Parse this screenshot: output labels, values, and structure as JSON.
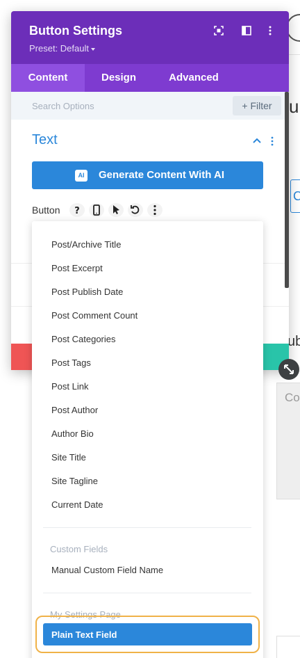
{
  "modal": {
    "title": "Button Settings",
    "preset": "Preset: Default",
    "header_icons": [
      "expand-icon",
      "sidebar-icon",
      "more-vertical-icon"
    ],
    "header_color": "#6c2eb9"
  },
  "tabs": [
    {
      "label": "Content",
      "active": true
    },
    {
      "label": "Design",
      "active": false
    },
    {
      "label": "Advanced",
      "active": false
    }
  ],
  "search": {
    "placeholder": "Search Options",
    "filter_label": "+ Filter"
  },
  "section": {
    "title": "Text"
  },
  "ai_button": {
    "badge": "AI",
    "label": "Generate Content With AI",
    "color": "#2b87da"
  },
  "field": {
    "label": "Button",
    "option_icons": [
      "help-icon",
      "mobile-icon",
      "cursor-icon",
      "undo-icon",
      "more-vertical-icon"
    ]
  },
  "dropdown": {
    "items": [
      "Post/Archive Title",
      "Post Excerpt",
      "Post Publish Date",
      "Post Comment Count",
      "Post Categories",
      "Post Tags",
      "Post Link",
      "Post Author",
      "Author Bio",
      "Site Title",
      "Site Tagline",
      "Current Date"
    ],
    "groups": [
      {
        "label": "Custom Fields",
        "items": [
          "Manual Custom Field Name"
        ]
      },
      {
        "label": "My Settings Page",
        "items": [
          "Plain Text Field"
        ]
      }
    ],
    "selected": "Plain Text Field",
    "highlight_color": "#f0b248"
  },
  "background": {
    "fragment_u": "u",
    "fragment_c": "C",
    "fragment_ub": "ub",
    "fragment_co": "Co"
  }
}
